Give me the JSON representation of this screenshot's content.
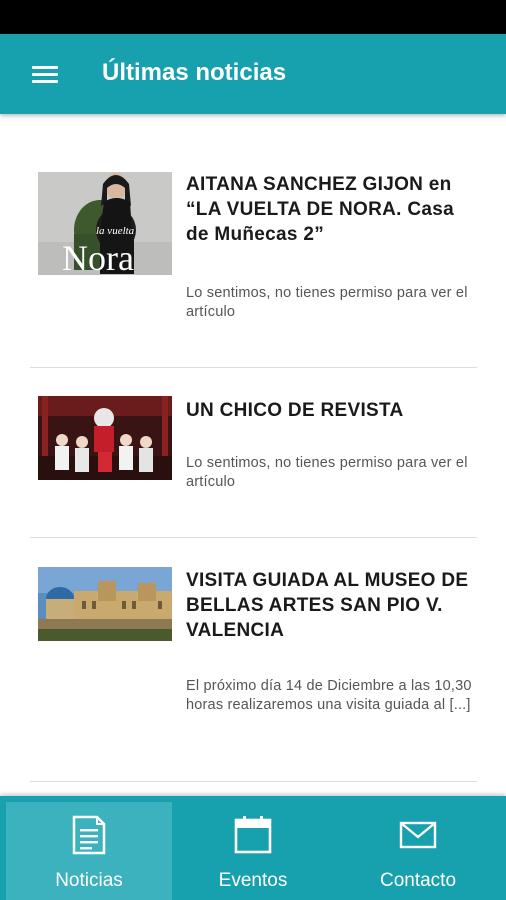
{
  "app_bar": {
    "title": "Últimas noticias",
    "menu_icon": "hamburger-menu-icon"
  },
  "articles": [
    {
      "title": "AITANA SANCHEZ GIJON en “LA VUELTA DE NORA. Casa de Muñecas 2”",
      "excerpt": "Lo sentimos, no tienes permiso para ver el artículo",
      "thumb_text": "Nora",
      "thumb_text_small": "la vuelta"
    },
    {
      "title": "UN CHICO DE REVISTA",
      "excerpt": "Lo sentimos, no tienes permiso para ver el artículo"
    },
    {
      "title": "VISITA GUIADA AL MUSEO DE BELLAS ARTES SAN PIO V. VALENCIA",
      "excerpt": "El próximo día 14 de Diciembre a las 10,30 horas realizaremos una visita guiada al [...]"
    }
  ],
  "bottom_nav": {
    "active": "Noticias",
    "items": [
      {
        "label": "Noticias",
        "icon": "document-icon"
      },
      {
        "label": "Eventos",
        "icon": "calendar-icon"
      },
      {
        "label": "Contacto",
        "icon": "envelope-icon"
      }
    ]
  },
  "colors": {
    "primary": "#17a0ad",
    "nav_active": "#3bb2bd",
    "status_bar": "#000000"
  }
}
